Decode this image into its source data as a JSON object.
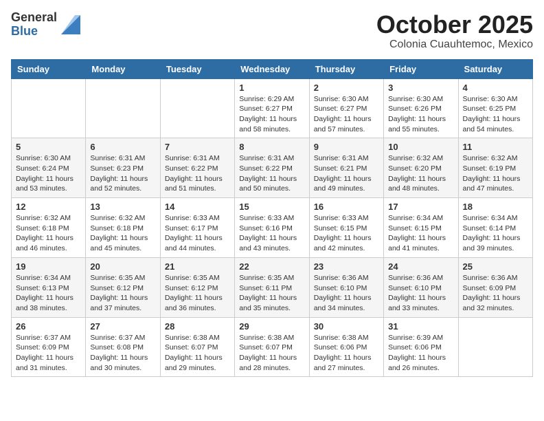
{
  "header": {
    "logo_general": "General",
    "logo_blue": "Blue",
    "month_title": "October 2025",
    "location": "Colonia Cuauhtemoc, Mexico"
  },
  "weekdays": [
    "Sunday",
    "Monday",
    "Tuesday",
    "Wednesday",
    "Thursday",
    "Friday",
    "Saturday"
  ],
  "weeks": [
    [
      {
        "day": "",
        "info": ""
      },
      {
        "day": "",
        "info": ""
      },
      {
        "day": "",
        "info": ""
      },
      {
        "day": "1",
        "info": "Sunrise: 6:29 AM\nSunset: 6:27 PM\nDaylight: 11 hours and 58 minutes."
      },
      {
        "day": "2",
        "info": "Sunrise: 6:30 AM\nSunset: 6:27 PM\nDaylight: 11 hours and 57 minutes."
      },
      {
        "day": "3",
        "info": "Sunrise: 6:30 AM\nSunset: 6:26 PM\nDaylight: 11 hours and 55 minutes."
      },
      {
        "day": "4",
        "info": "Sunrise: 6:30 AM\nSunset: 6:25 PM\nDaylight: 11 hours and 54 minutes."
      }
    ],
    [
      {
        "day": "5",
        "info": "Sunrise: 6:30 AM\nSunset: 6:24 PM\nDaylight: 11 hours and 53 minutes."
      },
      {
        "day": "6",
        "info": "Sunrise: 6:31 AM\nSunset: 6:23 PM\nDaylight: 11 hours and 52 minutes."
      },
      {
        "day": "7",
        "info": "Sunrise: 6:31 AM\nSunset: 6:22 PM\nDaylight: 11 hours and 51 minutes."
      },
      {
        "day": "8",
        "info": "Sunrise: 6:31 AM\nSunset: 6:22 PM\nDaylight: 11 hours and 50 minutes."
      },
      {
        "day": "9",
        "info": "Sunrise: 6:31 AM\nSunset: 6:21 PM\nDaylight: 11 hours and 49 minutes."
      },
      {
        "day": "10",
        "info": "Sunrise: 6:32 AM\nSunset: 6:20 PM\nDaylight: 11 hours and 48 minutes."
      },
      {
        "day": "11",
        "info": "Sunrise: 6:32 AM\nSunset: 6:19 PM\nDaylight: 11 hours and 47 minutes."
      }
    ],
    [
      {
        "day": "12",
        "info": "Sunrise: 6:32 AM\nSunset: 6:18 PM\nDaylight: 11 hours and 46 minutes."
      },
      {
        "day": "13",
        "info": "Sunrise: 6:32 AM\nSunset: 6:18 PM\nDaylight: 11 hours and 45 minutes."
      },
      {
        "day": "14",
        "info": "Sunrise: 6:33 AM\nSunset: 6:17 PM\nDaylight: 11 hours and 44 minutes."
      },
      {
        "day": "15",
        "info": "Sunrise: 6:33 AM\nSunset: 6:16 PM\nDaylight: 11 hours and 43 minutes."
      },
      {
        "day": "16",
        "info": "Sunrise: 6:33 AM\nSunset: 6:15 PM\nDaylight: 11 hours and 42 minutes."
      },
      {
        "day": "17",
        "info": "Sunrise: 6:34 AM\nSunset: 6:15 PM\nDaylight: 11 hours and 41 minutes."
      },
      {
        "day": "18",
        "info": "Sunrise: 6:34 AM\nSunset: 6:14 PM\nDaylight: 11 hours and 39 minutes."
      }
    ],
    [
      {
        "day": "19",
        "info": "Sunrise: 6:34 AM\nSunset: 6:13 PM\nDaylight: 11 hours and 38 minutes."
      },
      {
        "day": "20",
        "info": "Sunrise: 6:35 AM\nSunset: 6:12 PM\nDaylight: 11 hours and 37 minutes."
      },
      {
        "day": "21",
        "info": "Sunrise: 6:35 AM\nSunset: 6:12 PM\nDaylight: 11 hours and 36 minutes."
      },
      {
        "day": "22",
        "info": "Sunrise: 6:35 AM\nSunset: 6:11 PM\nDaylight: 11 hours and 35 minutes."
      },
      {
        "day": "23",
        "info": "Sunrise: 6:36 AM\nSunset: 6:10 PM\nDaylight: 11 hours and 34 minutes."
      },
      {
        "day": "24",
        "info": "Sunrise: 6:36 AM\nSunset: 6:10 PM\nDaylight: 11 hours and 33 minutes."
      },
      {
        "day": "25",
        "info": "Sunrise: 6:36 AM\nSunset: 6:09 PM\nDaylight: 11 hours and 32 minutes."
      }
    ],
    [
      {
        "day": "26",
        "info": "Sunrise: 6:37 AM\nSunset: 6:09 PM\nDaylight: 11 hours and 31 minutes."
      },
      {
        "day": "27",
        "info": "Sunrise: 6:37 AM\nSunset: 6:08 PM\nDaylight: 11 hours and 30 minutes."
      },
      {
        "day": "28",
        "info": "Sunrise: 6:38 AM\nSunset: 6:07 PM\nDaylight: 11 hours and 29 minutes."
      },
      {
        "day": "29",
        "info": "Sunrise: 6:38 AM\nSunset: 6:07 PM\nDaylight: 11 hours and 28 minutes."
      },
      {
        "day": "30",
        "info": "Sunrise: 6:38 AM\nSunset: 6:06 PM\nDaylight: 11 hours and 27 minutes."
      },
      {
        "day": "31",
        "info": "Sunrise: 6:39 AM\nSunset: 6:06 PM\nDaylight: 11 hours and 26 minutes."
      },
      {
        "day": "",
        "info": ""
      }
    ]
  ]
}
